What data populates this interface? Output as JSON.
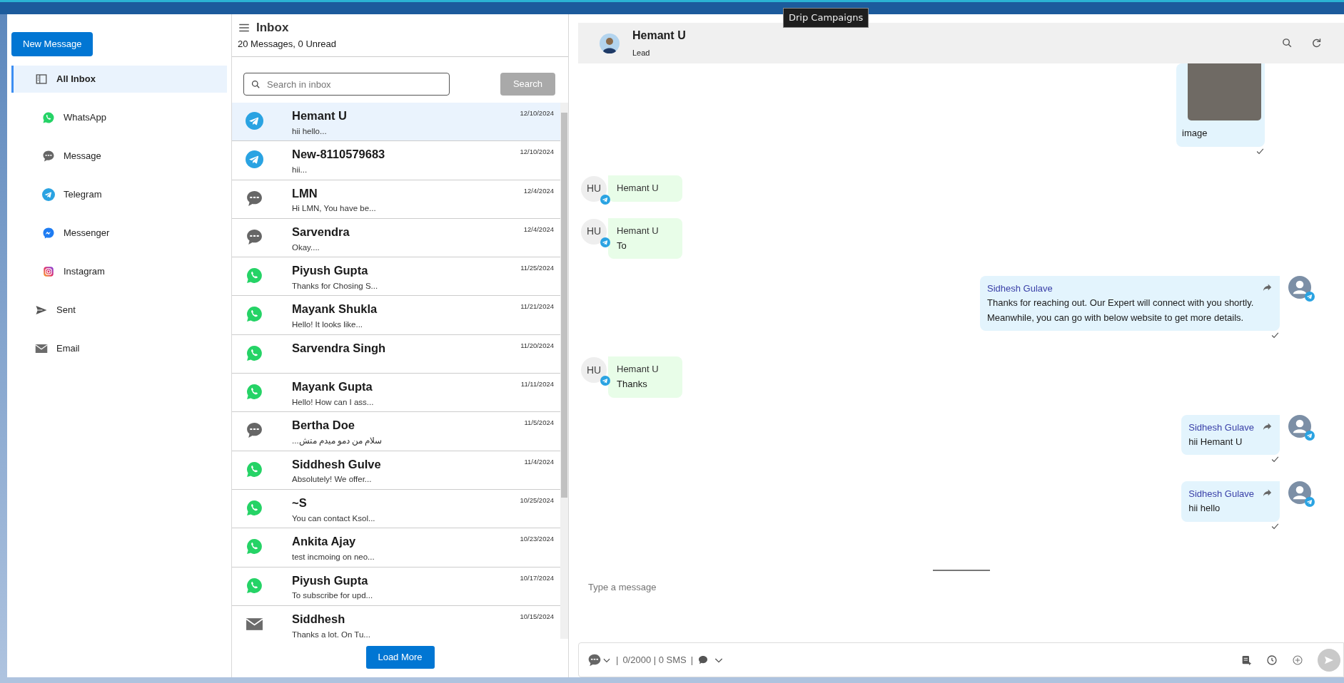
{
  "tooltip": "Drip Campaigns",
  "sidebar": {
    "new_message": "New Message",
    "items": [
      {
        "label": "All Inbox",
        "kind": "inbox",
        "selected": true,
        "children": [
          {
            "label": "WhatsApp",
            "kind": "whatsapp",
            "selected": false
          },
          {
            "label": "Message",
            "kind": "sms",
            "selected": false
          },
          {
            "label": "Telegram",
            "kind": "telegram",
            "selected": false
          },
          {
            "label": "Messenger",
            "kind": "messenger",
            "selected": false
          },
          {
            "label": "Instagram",
            "kind": "instagram",
            "selected": false
          }
        ]
      },
      {
        "label": "Sent",
        "kind": "sent",
        "selected": false
      },
      {
        "label": "Email",
        "kind": "email",
        "selected": false
      }
    ]
  },
  "inbox": {
    "title": "Inbox",
    "summary": "20 Messages, 0 Unread",
    "search": {
      "placeholder": "Search in inbox",
      "button": "Search",
      "disabled": true
    },
    "conversations": [
      {
        "kind": "telegram",
        "name": "Hemant U",
        "preview": "hii hello...",
        "date": "12/10/2024",
        "selected": true
      },
      {
        "kind": "telegram",
        "name": "New-8110579683",
        "preview": "hii...",
        "date": "12/10/2024",
        "selected": false
      },
      {
        "kind": "sms",
        "name": "LMN",
        "preview": "Hi LMN, You have be...",
        "date": "12/4/2024",
        "selected": false
      },
      {
        "kind": "sms",
        "name": "Sarvendra",
        "preview": "Okay....",
        "date": "12/4/2024",
        "selected": false
      },
      {
        "kind": "whatsapp",
        "name": "Piyush Gupta",
        "preview": "Thanks for Chosing S...",
        "date": "11/25/2024",
        "selected": false
      },
      {
        "kind": "whatsapp",
        "name": "Mayank Shukla",
        "preview": "Hello! It looks like...",
        "date": "11/21/2024",
        "selected": false
      },
      {
        "kind": "whatsapp",
        "name": "Sarvendra Singh",
        "date": "11/20/2024",
        "selected": false
      },
      {
        "kind": "whatsapp",
        "name": "Mayank Gupta",
        "preview": "Hello! How can I ass...",
        "date": "11/11/2024",
        "selected": false
      },
      {
        "kind": "sms",
        "name": "Bertha Doe",
        "preview": "سلام من دمو میدم متش...",
        "date": "11/5/2024",
        "selected": false
      },
      {
        "kind": "whatsapp",
        "name": "Siddhesh Gulve",
        "preview": "Absolutely! We offer...",
        "date": "11/4/2024",
        "selected": false
      },
      {
        "kind": "whatsapp",
        "name": "~S",
        "preview": "You can contact Ksol...",
        "date": "10/25/2024",
        "selected": false
      },
      {
        "kind": "whatsapp",
        "name": "Ankita Ajay",
        "preview": "test incmoing on neo...",
        "date": "10/23/2024",
        "selected": false
      },
      {
        "kind": "whatsapp",
        "name": "Piyush Gupta",
        "preview": "To subscribe for upd...",
        "date": "10/17/2024",
        "selected": false
      },
      {
        "kind": "email",
        "name": "Siddhesh",
        "preview": "Thanks a lot. On Tu...",
        "date": "10/15/2024",
        "selected": false
      }
    ],
    "load_more": "Load More"
  },
  "chat": {
    "contact": {
      "name": "Hemant U",
      "role": "Lead"
    },
    "messages": [
      {
        "kind": "outgoing_image",
        "caption": "image"
      },
      {
        "kind": "incoming",
        "initials": "HU",
        "sender": "Hemant U"
      },
      {
        "kind": "incoming",
        "initials": "HU",
        "sender": "Hemant U",
        "text": "To"
      },
      {
        "kind": "outgoing",
        "sender": "Sidhesh Gulave",
        "text": "Thanks for reaching out. Our Expert will connect with you shortly. Meanwhile, you can go with below website to get more details."
      },
      {
        "kind": "incoming",
        "initials": "HU",
        "sender": "Hemant U",
        "text": "Thanks"
      },
      {
        "kind": "outgoing",
        "sender": "Sidhesh Gulave",
        "text": "hii Hemant U"
      },
      {
        "kind": "outgoing",
        "sender": "Sidhesh Gulave",
        "text": "hii hello"
      }
    ],
    "composer": {
      "placeholder": "Type a message",
      "separator": "|",
      "counter": "0/2000 | 0 SMS",
      "separator_2": "|"
    }
  }
}
